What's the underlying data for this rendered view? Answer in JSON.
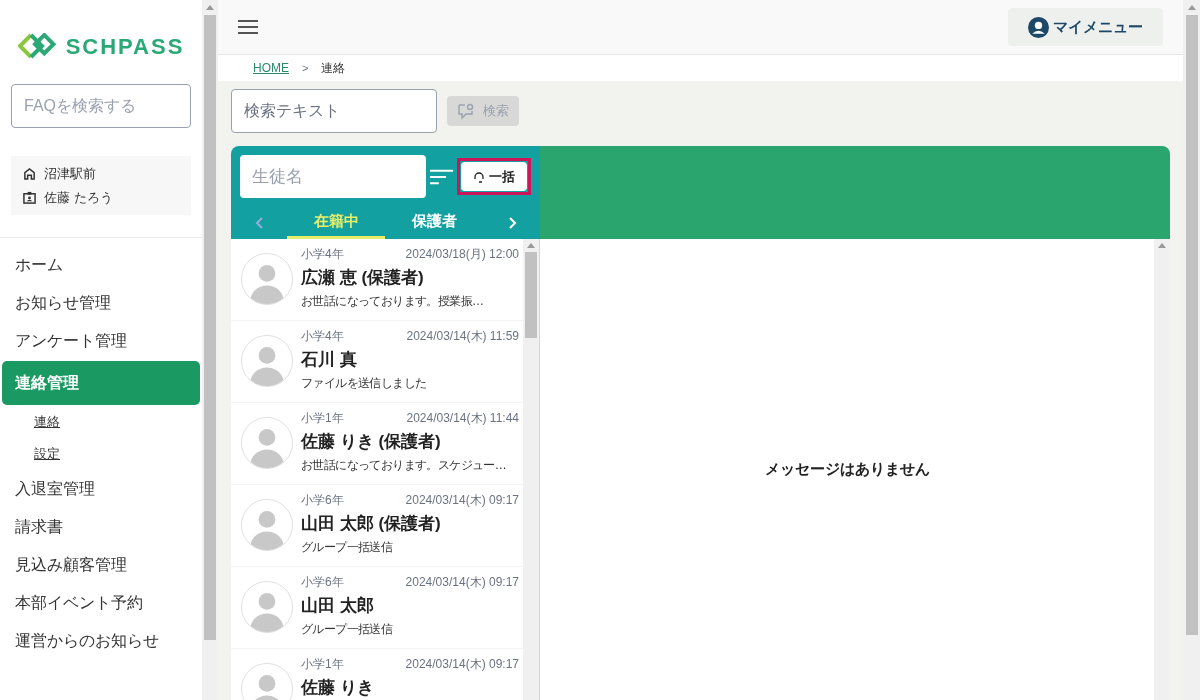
{
  "logo": {
    "text": "SCHPASS"
  },
  "faq_search": {
    "placeholder": "FAQを検索する"
  },
  "account": {
    "school": "沼津駅前",
    "user": "佐藤 たろう"
  },
  "nav": [
    {
      "label": "ホーム",
      "selected": false
    },
    {
      "label": "お知らせ管理",
      "selected": false
    },
    {
      "label": "アンケート管理",
      "selected": false
    },
    {
      "label": "連絡管理",
      "selected": true,
      "children": [
        {
          "label": "連絡"
        },
        {
          "label": "設定"
        }
      ]
    },
    {
      "label": "入退室管理",
      "selected": false
    },
    {
      "label": "請求書",
      "selected": false
    },
    {
      "label": "見込み顧客管理",
      "selected": false
    },
    {
      "label": "本部イベント予約",
      "selected": false
    },
    {
      "label": "運営からのお知らせ",
      "selected": false
    }
  ],
  "my_menu": "マイメニュー",
  "breadcrumb": [
    "HOME",
    "連絡"
  ],
  "breadcrumb_separator": ">",
  "search": {
    "placeholder": "検索テキスト",
    "button": "検索",
    "disabled": true
  },
  "student_search": {
    "placeholder": "生徒名"
  },
  "bulk_button": "一括",
  "tabs": [
    {
      "label": "在籍中",
      "selected": true
    },
    {
      "label": "保護者",
      "selected": false
    }
  ],
  "messages": [
    {
      "grade": "小学4年",
      "time": "2024/03/18(月) 12:00",
      "name": "広瀬 恵 (保護者)",
      "preview": "お世話になっております。授業振…"
    },
    {
      "grade": "小学4年",
      "time": "2024/03/14(木) 11:59",
      "name": "石川 真",
      "preview": "ファイルを送信しました"
    },
    {
      "grade": "小学1年",
      "time": "2024/03/14(木) 11:44",
      "name": "佐藤 りき (保護者)",
      "preview": "お世話になっております。スケジュー…"
    },
    {
      "grade": "小学6年",
      "time": "2024/03/14(木) 09:17",
      "name": "山田 太郎 (保護者)",
      "preview": "グループ一括送信"
    },
    {
      "grade": "小学6年",
      "time": "2024/03/14(木) 09:17",
      "name": "山田 太郎",
      "preview": "グループ一括送信"
    },
    {
      "grade": "小学1年",
      "time": "2024/03/14(木) 09:17",
      "name": "佐藤 りき"
    }
  ],
  "empty_message": "メッセージはありません"
}
